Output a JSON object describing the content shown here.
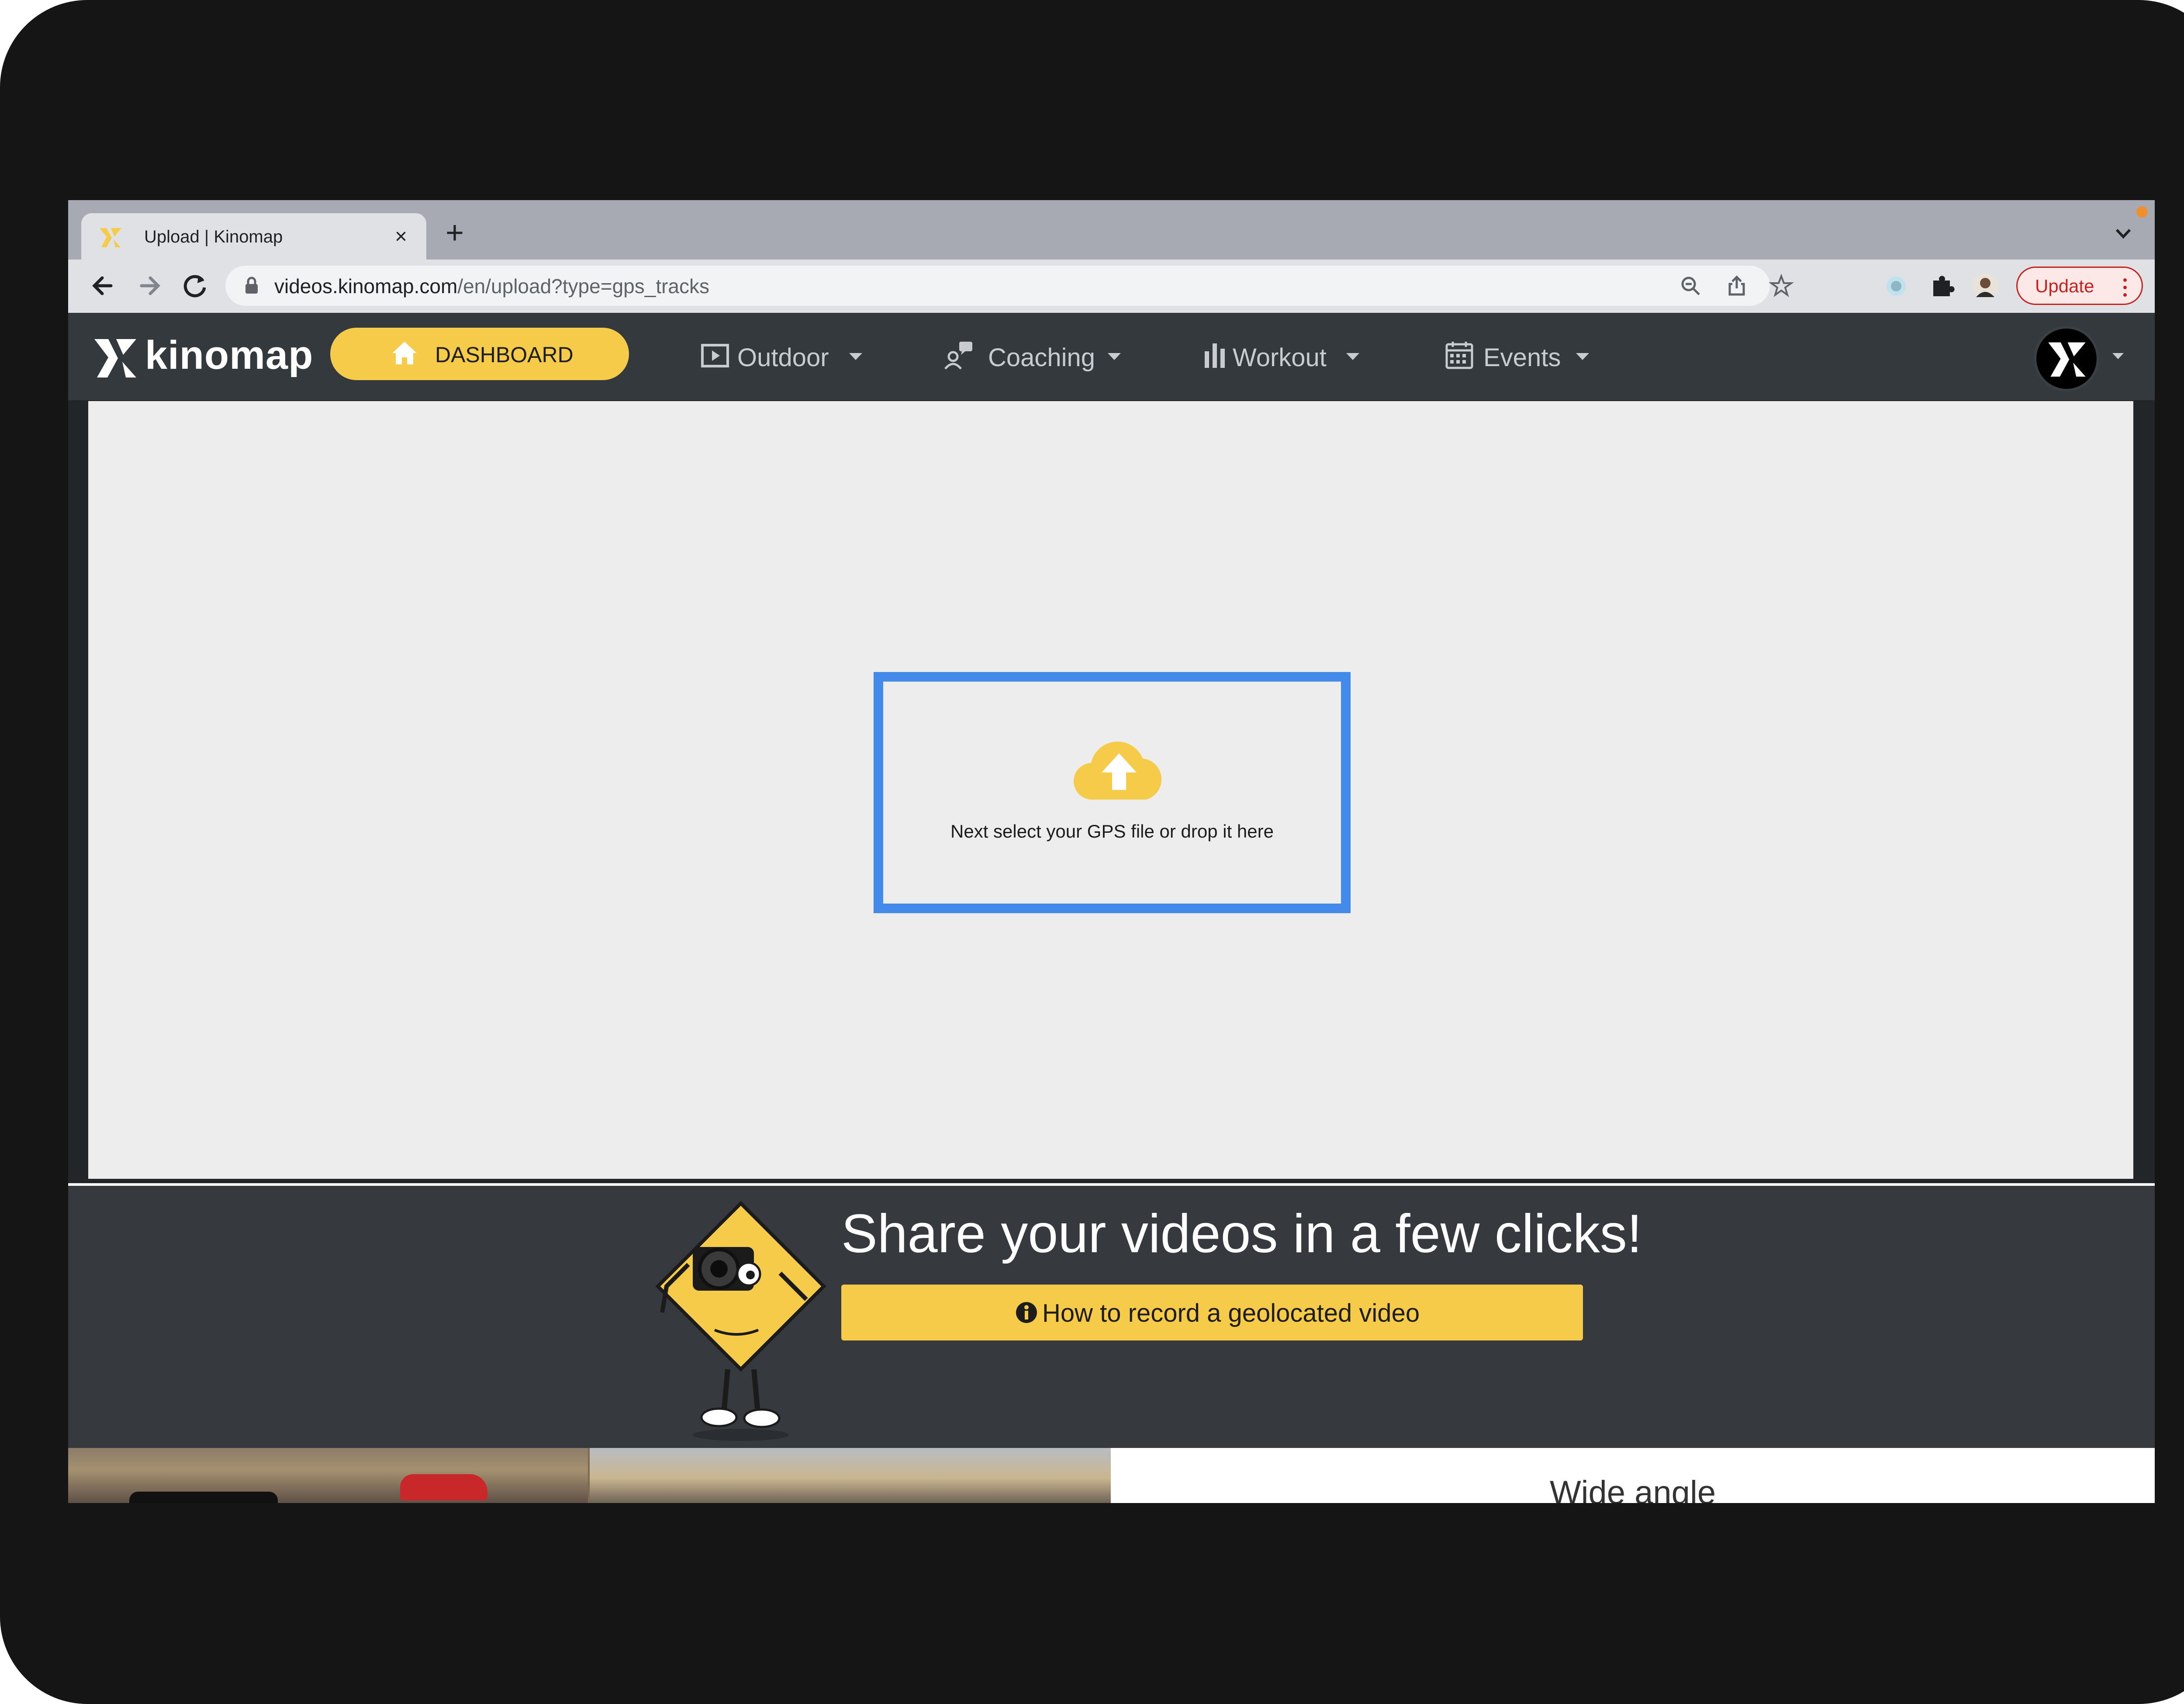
{
  "browser": {
    "tab_title": "Upload | Kinomap",
    "tab_close_glyph": "×",
    "new_tab_glyph": "+",
    "url_host": "videos.kinomap.com",
    "url_path": "/en/upload?type=gps_tracks",
    "update_label": "Update"
  },
  "header": {
    "logo_text": "kinomap",
    "dashboard_label": "DASHBOARD",
    "nav": [
      {
        "label": "Outdoor",
        "icon": "play-box-icon"
      },
      {
        "label": "Coaching",
        "icon": "coach-icon"
      },
      {
        "label": "Workout",
        "icon": "bars-icon"
      },
      {
        "label": "Events",
        "icon": "calendar-icon"
      }
    ]
  },
  "upload": {
    "dropzone_text": "Next select your GPS file or drop it here",
    "accent": "#448aea"
  },
  "promo": {
    "title": "Share your videos in a few clicks!",
    "button_label": "How to record a geolocated video"
  },
  "bottom": {
    "panel_label": "Wide angle"
  },
  "colors": {
    "brand_yellow": "#f6cb49",
    "header_bg": "#34393e",
    "panel_bg": "#ededed"
  }
}
